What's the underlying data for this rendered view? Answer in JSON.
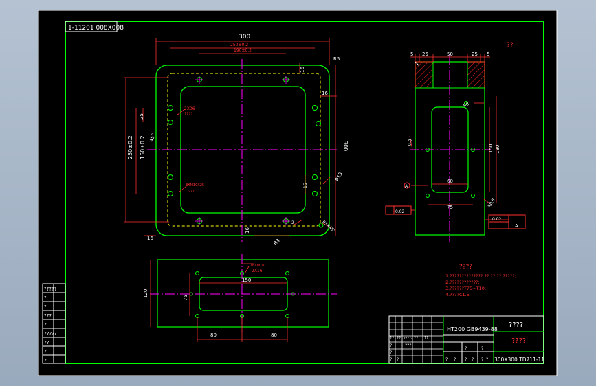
{
  "colors": {
    "background": "#000000",
    "border": "#00ff00",
    "part_outline": "#00ff00",
    "dimension": "#ff3030",
    "centerline": "#ff00ff",
    "hidden": "#ffff00",
    "hatch": "#ff0000",
    "text_white": "#ffffff",
    "note_text": "#ff3030"
  },
  "drawing_code_label": "1-11201 008X008",
  "top_view": {
    "dim_width_300": "300",
    "dim_250": "250±0.2",
    "dim_190": "190±0.2",
    "dim_16_top": "16",
    "dim_r15_top": "R5",
    "dim_16_right": "16",
    "dim_height_300": "300",
    "dim_250_vert": "250±0.2",
    "dim_150_vert": "150±0.2",
    "dim_25_left": "25",
    "dim_45_left": "45°",
    "dim_16_bottom": "16",
    "dim_r5_bottom": "R3",
    "dim_16_bot_label": "16",
    "dim_r15_right": "R15",
    "dim_15_side": "15",
    "dim_u2": "2",
    "note_holes_top": "2X06",
    "note_holes_top_2": "????",
    "note_thread": "8XM10X25",
    "note_thread_2": "????",
    "note_corner": "R5X45°"
  },
  "side_view": {
    "dim_5_left": "5",
    "dim_25_left": "25",
    "dim_50": "50",
    "dim_25_right": "25",
    "dim_5_right": "5",
    "dim_qq": "??",
    "dim_150": "150",
    "dim_180": "180",
    "dim_60": "60",
    "dim_75": "75",
    "dim_m8": "R8",
    "dim_r0_8": "0.8",
    "dim_rho": "R0.8",
    "balloon_A": "A",
    "gdt_value": "0.02",
    "gdt_flat": "0.02",
    "gdt_ref": "A"
  },
  "front_view": {
    "dim_120": "120",
    "dim_75": "75",
    "dim_150": "150",
    "dim_80_left": "80",
    "dim_80_right": "80",
    "note_hole": "16XM10",
    "note_hole_2": "2X16"
  },
  "notes": {
    "title": "????",
    "lines": [
      "1.??????????????.??.??.??.?????;",
      "2.????????????;",
      "3.??????T75~T10;",
      "4.????C1.5"
    ]
  },
  "title_block": {
    "material": "HT200 GB9439-88",
    "name": "????",
    "company": "????",
    "part_number": "300X300 TD711-11",
    "row_labels": [
      "?",
      "?",
      "?",
      "?"
    ],
    "header_cells": [
      "??",
      "??",
      "?????",
      "??",
      "??"
    ],
    "small_cells": [
      "?",
      "?",
      "?",
      "?",
      "?",
      "?",
      "?",
      "?"
    ],
    "sub_label": "???"
  },
  "left_panel_rows": [
    "?????",
    "?",
    "?",
    "???",
    "?",
    "?????",
    "??",
    "?",
    "?"
  ]
}
